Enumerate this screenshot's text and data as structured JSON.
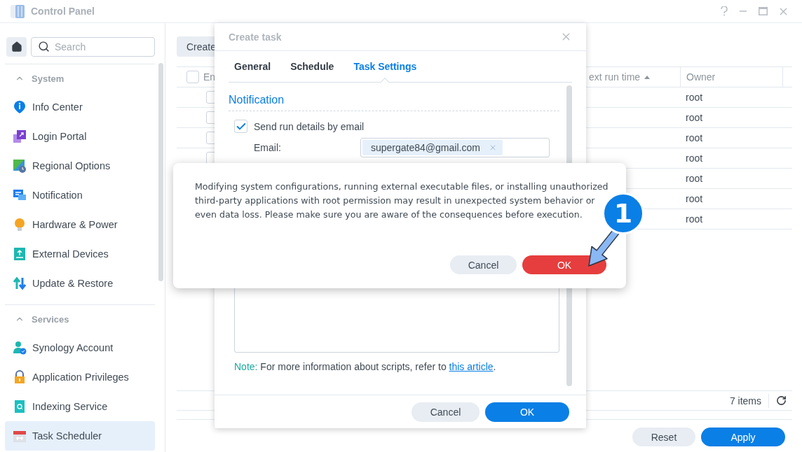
{
  "window": {
    "title": "Control Panel"
  },
  "sidebar": {
    "search": {
      "placeholder": "Search"
    },
    "sections": [
      {
        "title": "System",
        "expanded": true,
        "items": [
          {
            "label": "Info Center",
            "kind": "info",
            "selected": false
          },
          {
            "label": "Login Portal",
            "kind": "login",
            "selected": false
          },
          {
            "label": "Regional Options",
            "kind": "regional",
            "selected": false
          },
          {
            "label": "Notification",
            "kind": "notification",
            "selected": false
          },
          {
            "label": "Hardware & Power",
            "kind": "hardware",
            "selected": false
          },
          {
            "label": "External Devices",
            "kind": "external",
            "selected": false
          },
          {
            "label": "Update & Restore",
            "kind": "update",
            "selected": false
          }
        ]
      },
      {
        "title": "Services",
        "expanded": true,
        "items": [
          {
            "label": "Synology Account",
            "kind": "account",
            "selected": false
          },
          {
            "label": "Application Privileges",
            "kind": "privileges",
            "selected": false
          },
          {
            "label": "Indexing Service",
            "kind": "indexing",
            "selected": false
          },
          {
            "label": "Task Scheduler",
            "kind": "scheduler",
            "selected": true
          }
        ]
      }
    ]
  },
  "main": {
    "create_button": "Create",
    "table": {
      "header_checked": false,
      "columns": [
        {
          "label": "En"
        },
        {
          "label": "ext run time",
          "sort_ascending": true
        },
        {
          "label": "Owner"
        }
      ],
      "rows": [
        {
          "checked": false,
          "owner": "root"
        },
        {
          "checked": false,
          "owner": "root"
        },
        {
          "checked": false,
          "owner": "root"
        },
        {
          "checked": false,
          "owner": "root"
        },
        {
          "owner": "root"
        },
        {
          "owner": "root"
        },
        {
          "owner": "root"
        }
      ],
      "count": "7 items"
    },
    "buttons": [
      {
        "label": "Reset",
        "kind": "secondary"
      },
      {
        "label": "Apply",
        "kind": "primary"
      }
    ]
  },
  "task_dialog": {
    "title": "Create task",
    "tabs": [
      {
        "label": "General",
        "selected": false
      },
      {
        "label": "Schedule",
        "selected": false
      },
      {
        "label": "Task Settings",
        "selected": true
      }
    ],
    "section_title": "Notification",
    "send_email": {
      "label": "Send run details by email",
      "checked": true
    },
    "email": {
      "label": "Email:",
      "chips": [
        {
          "value": "supergate84@gmail.com"
        }
      ]
    },
    "note": {
      "prefix": "Note:",
      "text": "For more information about scripts, refer to",
      "link": "this article",
      "suffix": "."
    },
    "buttons": [
      {
        "label": "Cancel",
        "kind": "secondary"
      },
      {
        "label": "OK",
        "kind": "primary"
      }
    ]
  },
  "warning_dialog": {
    "message": "Modifying system configurations, running external executable files, or installing unauthorized third-party applications with root permission may result in unexpected system behavior or even data loss. Please make sure you are aware of the consequences before execution.",
    "buttons": [
      {
        "label": "Cancel",
        "kind": "secondary"
      },
      {
        "label": "OK",
        "kind": "danger"
      }
    ]
  },
  "annotation": {
    "label": "1"
  }
}
